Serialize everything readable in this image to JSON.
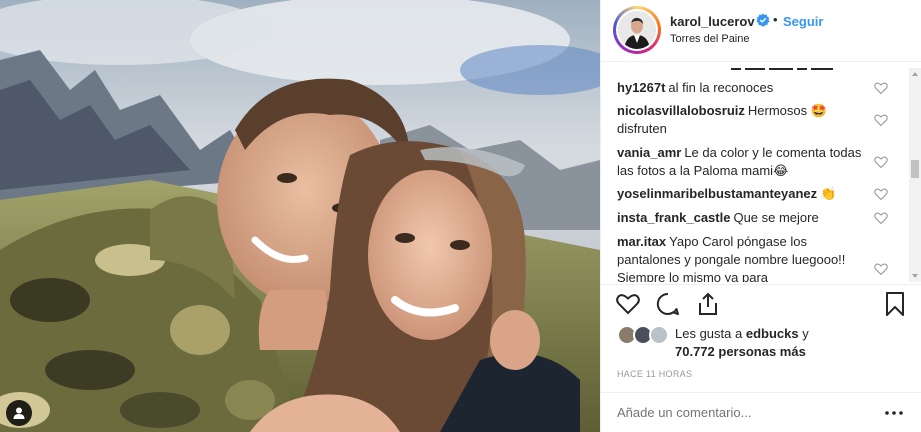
{
  "post": {
    "username": "karol_lucerov",
    "verified": true,
    "follow_label": "Seguir",
    "separator": "•",
    "location": "Torres del Paine"
  },
  "comments": [
    {
      "user": "hy1267t",
      "text": "al fin la reconoces"
    },
    {
      "user": "nicolasvillalobosruiz",
      "text": "Hermosos 🤩 disfruten"
    },
    {
      "user": "vania_amr",
      "text": "Le da color y le comenta todas las fotos a la Paloma mami😂"
    },
    {
      "user": "yoselinmaribelbustamanteyanez",
      "text": "👏"
    },
    {
      "user": "insta_frank_castle",
      "text": "Que se mejore"
    },
    {
      "user": "mar.itax",
      "text": "Yapo Carol póngase los pantalones y pongale nombre luegooo!! Siempre lo mismo ya para"
    }
  ],
  "likes": {
    "prefix": "Les gusta a",
    "first_user": "edbucks",
    "suffix": "y",
    "count_text": "70.772 personas más"
  },
  "timestamp": "HACE 11 HORAS",
  "add_comment_placeholder": "Añade un comentario...",
  "icons": [
    "heart-icon",
    "comment-icon",
    "share-icon",
    "bookmark-icon",
    "more-options-icon",
    "verified-badge-icon",
    "user-tag-icon"
  ],
  "colors": {
    "follow": "#3897f0",
    "verified": "#3897f0",
    "text": "#262626",
    "muted": "#999999"
  }
}
